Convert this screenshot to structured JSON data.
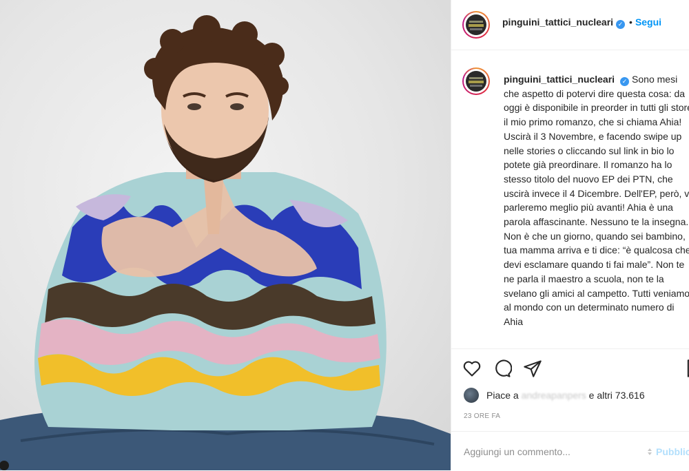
{
  "post": {
    "image_alt": "photo",
    "author": "pinguini_tattici_nucleari",
    "follow_label": "Segui",
    "header_separator": "•",
    "caption_text": "Sono mesi che aspetto di potervi dire questa cosa: da oggi è disponibile in preorder in tutti gli store il mio primo romanzo, che si chiama Ahia! Uscirà il 3 Novembre, e facendo swipe up nelle stories o cliccando sul link in bio lo potete già preordinare. Il romanzo ha lo stesso titolo del nuovo EP dei PTN, che uscirà invece il 4 Dicembre. Dell'EP, però, vi parleremo meglio più avanti! Ahia è una parola affascinante. Nessuno te la insegna. Non è che un giorno, quando sei bambino, tua mamma arriva e ti dice: “è qualcosa che devi esclamare quando ti fai male”. Non te ne parla il maestro a scuola, non te la svelano gli amici al campetto. Tutti veniamo al mondo con un determinato numero di Ahia"
  },
  "likes": {
    "prefix": "Piace a",
    "user_blurred": "andreapanpers",
    "suffix": "e altri 73.616"
  },
  "time_label": "23 ORE FA",
  "comment": {
    "placeholder": "Aggiungi un commento...",
    "publish_label": "Pubblica"
  },
  "icons": {
    "like": "heart-icon",
    "comment": "comment-icon",
    "share": "share-icon",
    "save": "bookmark-icon",
    "verified": "verified-badge-icon",
    "emoji": "emoji-icon"
  },
  "colors": {
    "accent": "#0095f6",
    "verified": "#3897f0",
    "muted": "#8e8e8e",
    "publish_disabled": "#b2dffc"
  }
}
